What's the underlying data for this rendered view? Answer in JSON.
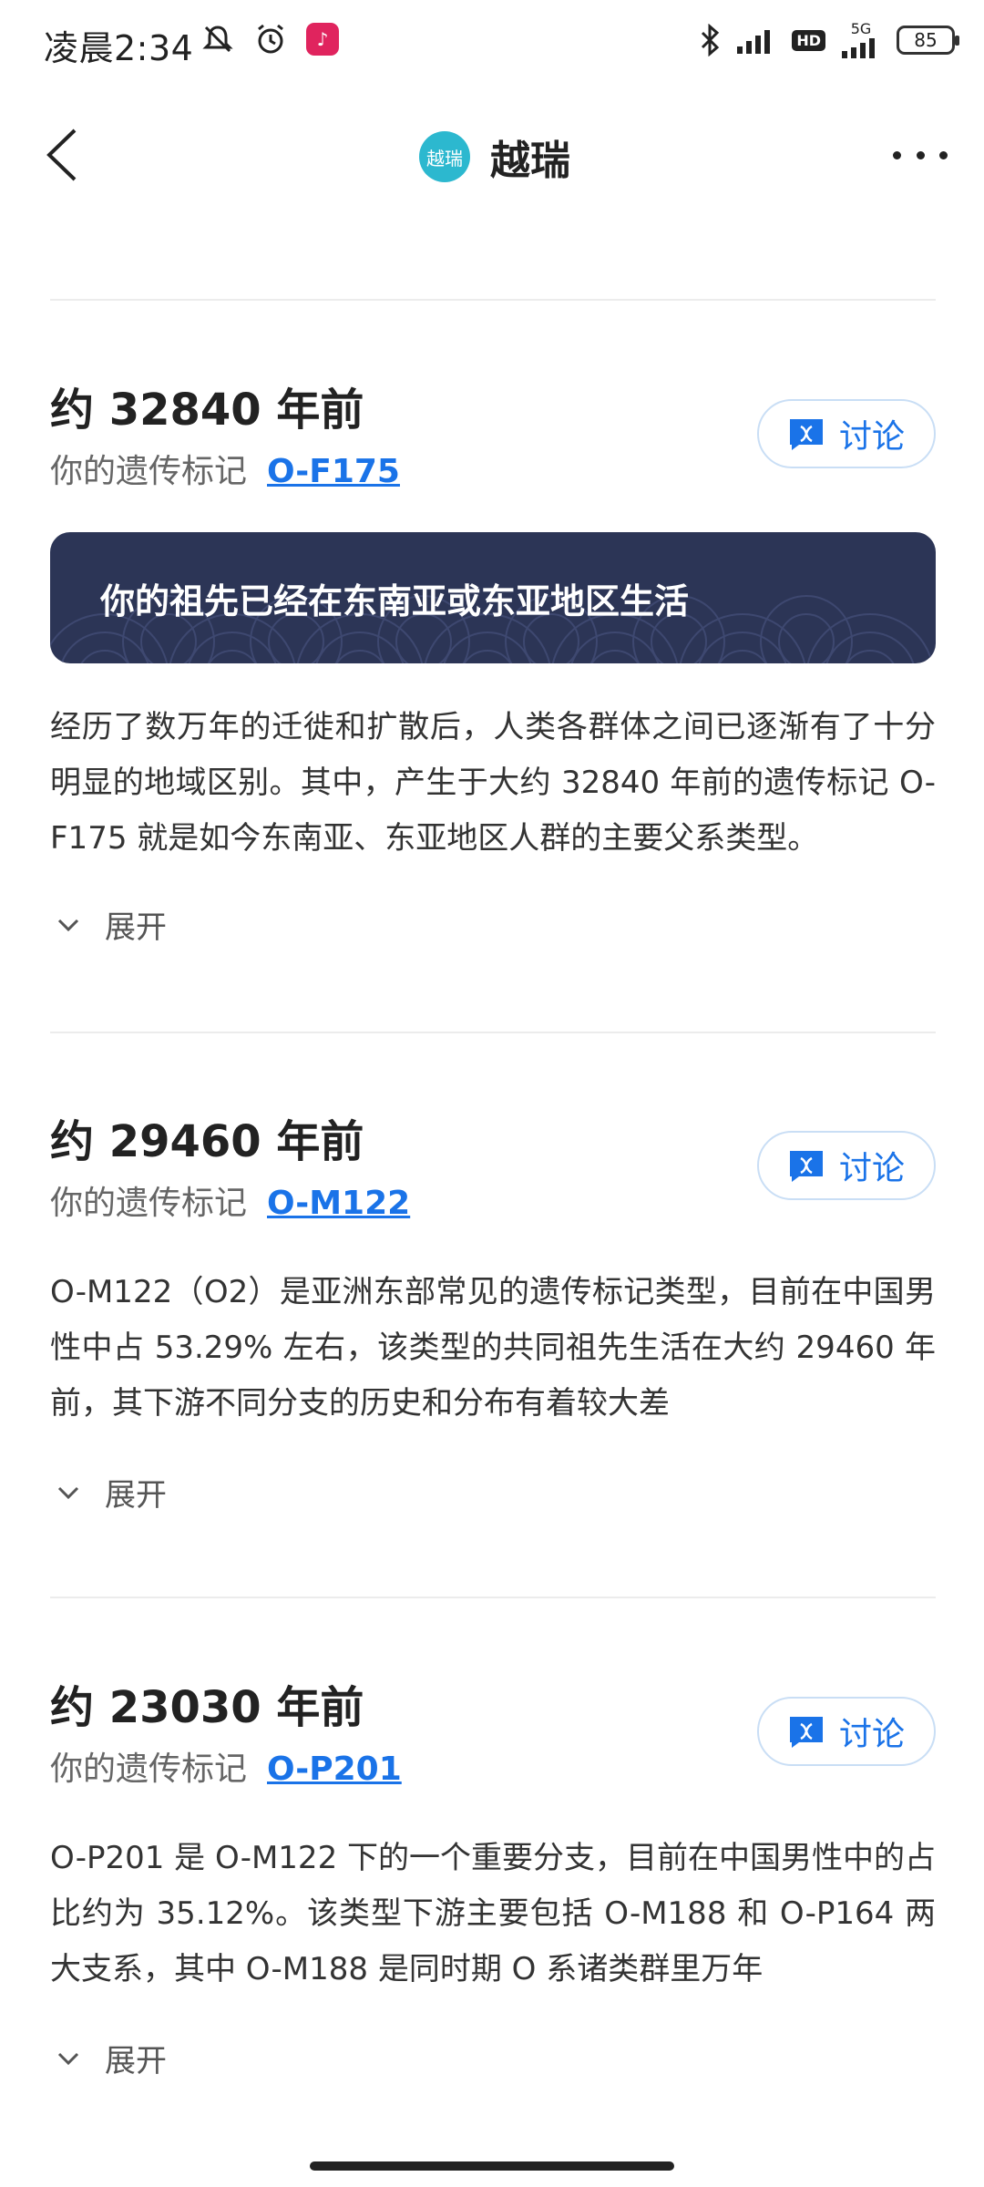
{
  "status_bar": {
    "time": "凌晨2:34",
    "network": "5G",
    "hd": "HD",
    "battery": "85"
  },
  "header": {
    "logo_text": "越瑞",
    "title": "越瑞"
  },
  "sections": [
    {
      "year": "约 32840 年前",
      "marker_label": "你的遗传标记",
      "marker": "O-F175",
      "discuss": "讨论",
      "banner": "你的祖先已经在东南亚或东亚地区生活",
      "body": "经历了数万年的迁徙和扩散后，人类各群体之间已逐渐有了十分明显的地域区别。其中，产生于大约 32840 年前的遗传标记 O-F175 就是如今东南亚、东亚地区人群的主要父系类型。",
      "expand": "展开"
    },
    {
      "year": "约 29460 年前",
      "marker_label": "你的遗传标记",
      "marker": "O-M122",
      "discuss": "讨论",
      "body": "O-M122（O2）是亚洲东部常见的遗传标记类型，目前在中国男性中占 53.29% 左右，该类型的共同祖先生活在大约 29460 年前，其下游不同分支的历史和分布有着较大差",
      "expand": "展开"
    },
    {
      "year": "约 23030 年前",
      "marker_label": "你的遗传标记",
      "marker": "O-P201",
      "discuss": "讨论",
      "body": "O-P201 是 O-M122 下的一个重要分支，目前在中国男性中的占比约为 35.12%。该类型下游主要包括 O-M188 和 O-P164 两大支系，其中 O-M188 是同时期 O 系诸类群里万年",
      "expand": "展开"
    }
  ],
  "colors": {
    "accent": "#1a73e8",
    "banner_bg": "#2c3556",
    "logo": "#2cb8cf"
  }
}
